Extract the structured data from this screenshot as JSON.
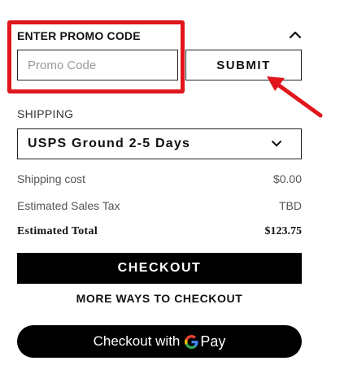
{
  "promo": {
    "title": "ENTER PROMO CODE",
    "input_placeholder": "Promo Code",
    "input_value": "",
    "submit_label": "SUBMIT"
  },
  "shipping": {
    "label": "SHIPPING",
    "selected_option": "USPS Ground 2-5 Days"
  },
  "summary": {
    "shipping_cost_label": "Shipping cost",
    "shipping_cost_value": "$0.00",
    "tax_label": "Estimated Sales Tax",
    "tax_value": "TBD",
    "total_label": "Estimated Total",
    "total_value": "$123.75"
  },
  "actions": {
    "checkout_label": "CHECKOUT",
    "more_ways_label": "MORE WAYS TO CHECKOUT",
    "gpay_prefix": "Checkout with",
    "gpay_suffix": "Pay"
  },
  "icons": {
    "collapse": "chevron-up-icon",
    "select": "chevron-down-icon",
    "gpay": "google-g-icon"
  },
  "colors": {
    "annotation_red": "#e0161c",
    "primary_black": "#000000",
    "muted_text": "#555555"
  }
}
